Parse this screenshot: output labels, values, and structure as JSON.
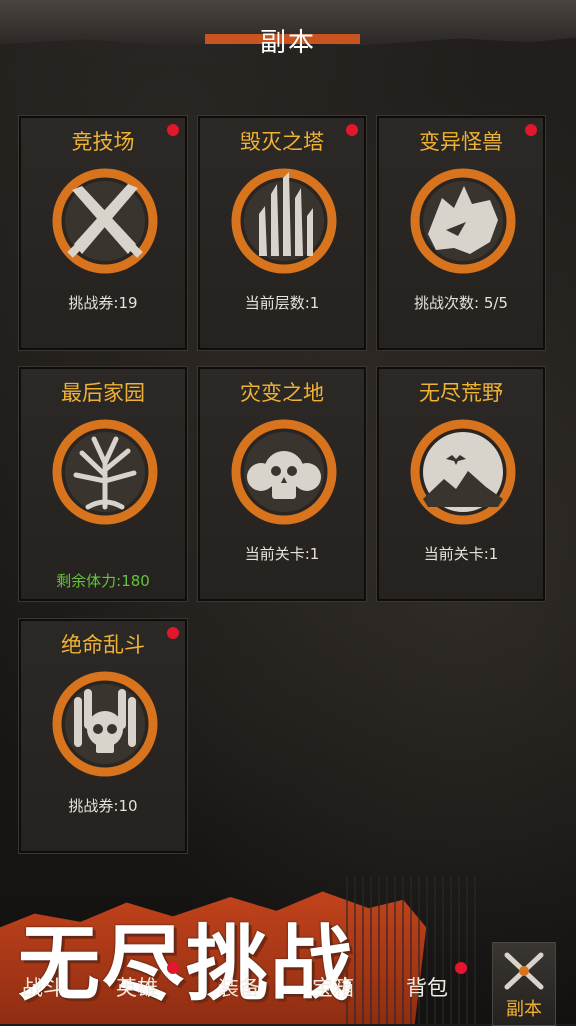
{
  "header": {
    "title": "副本"
  },
  "cards": [
    {
      "title": "竞技场",
      "info": "挑战券:19",
      "has_dot": true,
      "icon": "crossed-knives-icon"
    },
    {
      "title": "毁灭之塔",
      "info": "当前层数:1",
      "has_dot": true,
      "icon": "ruined-tower-icon"
    },
    {
      "title": "变异怪兽",
      "info": "挑战次数:  5/5",
      "has_dot": true,
      "icon": "wolf-head-icon"
    },
    {
      "title": "最后家园",
      "info": "剩余体力:180",
      "has_dot": false,
      "icon": "tree-icon"
    },
    {
      "title": "灾变之地",
      "info": "当前关卡:1",
      "has_dot": false,
      "icon": "skulls-icon"
    },
    {
      "title": "无尽荒野",
      "info": "当前关卡:1",
      "has_dot": false,
      "icon": "moon-bat-mountain-icon"
    },
    {
      "title": "绝命乱斗",
      "info": "挑战券:10",
      "has_dot": true,
      "icon": "skull-hands-icon"
    }
  ],
  "banner": {
    "text": "无尽挑战"
  },
  "bottom_nav": [
    {
      "label": "战斗"
    },
    {
      "label": "英雄"
    },
    {
      "label": "装备"
    },
    {
      "label": "宝箱"
    },
    {
      "label": "背包"
    },
    {
      "label": "副本",
      "icon": "crossed-weapons-icon"
    }
  ],
  "colors": {
    "accent": "#f0b235",
    "ring": "#d8741e",
    "dot": "#e3162c",
    "stamina": "#63c53a"
  }
}
